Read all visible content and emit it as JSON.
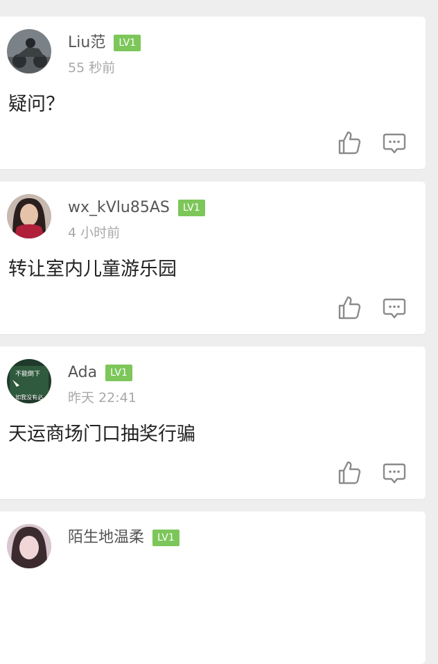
{
  "comments": [
    {
      "username": "Liu范",
      "level": "LV1",
      "time": "55 秒前",
      "content": "疑问？",
      "avatar_icon": "avatar-motorcycle"
    },
    {
      "username": "wx_kVlu85AS",
      "level": "LV1",
      "time": "4 小时前",
      "content": "转让室内儿童游乐园",
      "avatar_icon": "avatar-woman-red-scarf"
    },
    {
      "username": "Ada",
      "level": "LV1",
      "time": "昨天 22:41",
      "content": "天运商场门口抽奖行骗",
      "avatar_icon": "avatar-meme-sticker",
      "avatar_text_top": "不能倒下",
      "avatar_text_bottom": "如我没有必"
    },
    {
      "username": "陌生地温柔",
      "level": "LV1",
      "time": "",
      "content": "",
      "avatar_icon": "avatar-girl"
    }
  ],
  "colors": {
    "background": "#eeeeee",
    "card": "#ffffff",
    "level_badge": "#7cc65a",
    "username": "#555555",
    "time": "#a8a8a8",
    "icon": "#8a8a8a"
  }
}
